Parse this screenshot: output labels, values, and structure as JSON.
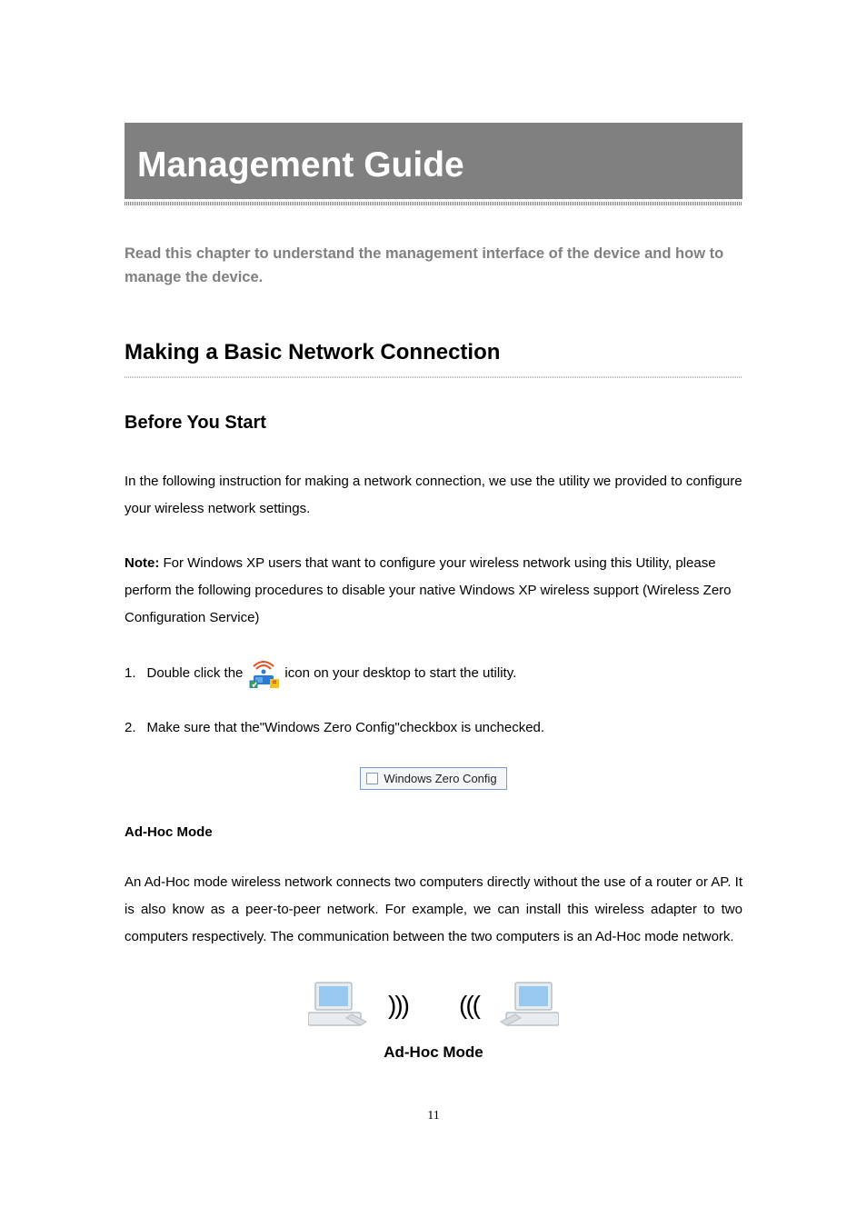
{
  "title": "Management Guide",
  "intro": "Read this chapter to understand the management interface of the device and how to manage the device.",
  "section1_heading": "Making a Basic Network Connection",
  "section2_heading": "Before You Start",
  "para1": "In the following instruction for making a network connection, we use the utility we provided to configure your wireless network settings.",
  "note_label": "Note:",
  "note_text": " For Windows XP users that want to configure your wireless network using this Utility, please perform the following procedures to disable your native Windows XP wireless support (Wireless Zero Configuration Service)",
  "step1_num": "1.",
  "step1_pre": "Double click the ",
  "step1_post": " icon on your desktop to start the utility.",
  "step2_num": "2.",
  "step2_pre": "Make sure that the ",
  "step2_bold": "\"Windows Zero Config\"",
  "step2_post": " checkbox is unchecked.",
  "zero_config_label": "Windows Zero Config",
  "adhoc_heading": "Ad-Hoc Mode",
  "adhoc_para": "An Ad-Hoc mode wireless network connects two computers directly without the use of a router or AP.   It is also know as a peer-to-peer network. For example, we can install this wireless adapter to two computers respectively. The communication between the two computers is an Ad-Hoc mode network.",
  "diagram_label": "Ad-Hoc Mode",
  "page_number": "11"
}
